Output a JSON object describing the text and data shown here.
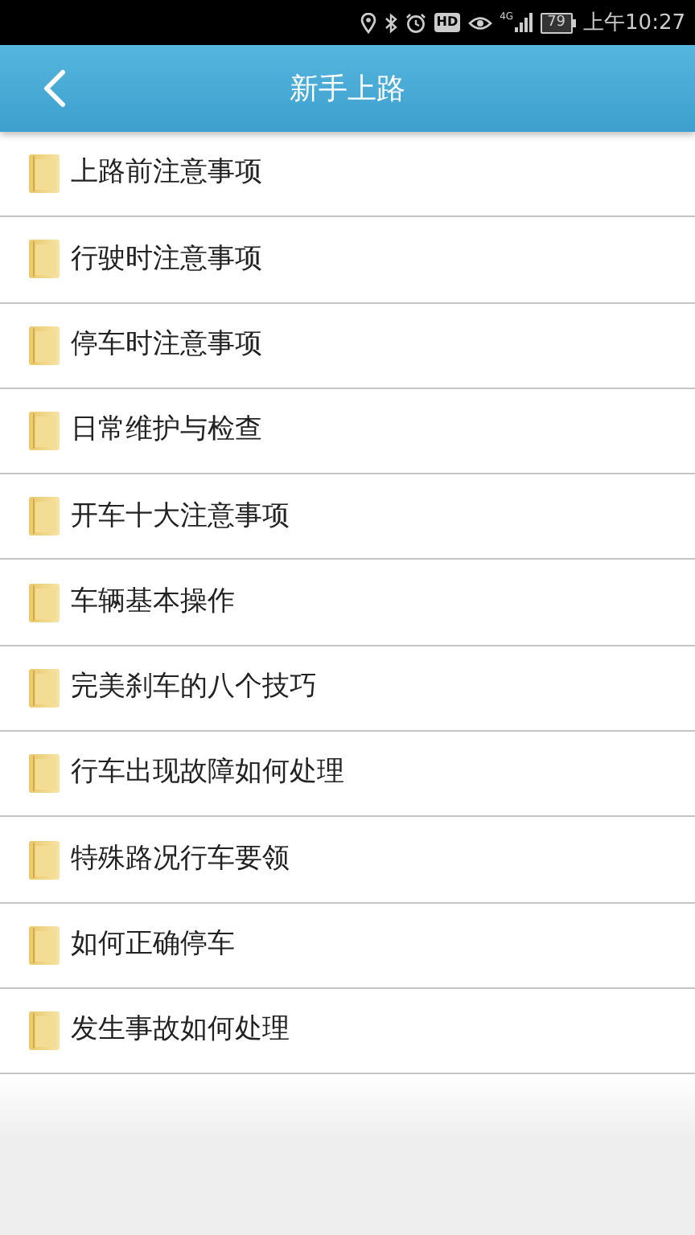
{
  "status_bar": {
    "hd": "HD",
    "network": "4G",
    "battery": "79",
    "time": "上午10:27"
  },
  "header": {
    "title": "新手上路"
  },
  "items": [
    {
      "label": "上路前注意事项"
    },
    {
      "label": "行驶时注意事项"
    },
    {
      "label": "停车时注意事项"
    },
    {
      "label": "日常维护与检查"
    },
    {
      "label": "开车十大注意事项"
    },
    {
      "label": "车辆基本操作"
    },
    {
      "label": "完美刹车的八个技巧"
    },
    {
      "label": "行车出现故障如何处理"
    },
    {
      "label": "特殊路况行车要领"
    },
    {
      "label": "如何正确停车"
    },
    {
      "label": "发生事故如何处理"
    }
  ]
}
